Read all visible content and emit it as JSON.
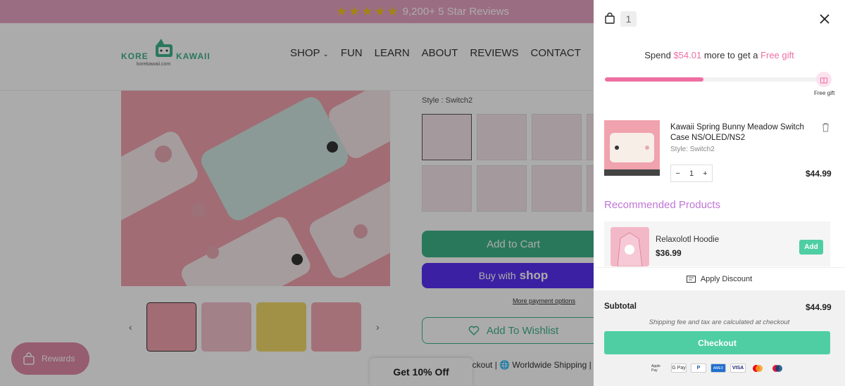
{
  "announcement": {
    "text": "9,200+ 5 Star Reviews",
    "stars": "★★★★★"
  },
  "logo": {
    "left_word": "KORE",
    "right_word": "KAWAII",
    "sub": "korekawaii.com"
  },
  "nav": [
    "SHOP",
    "FUN",
    "LEARN",
    "ABOUT",
    "REVIEWS",
    "CONTACT"
  ],
  "product": {
    "style_label": "Style : Switch2",
    "add_to_cart": "Add to Cart",
    "buy_with": "Buy with",
    "shop_word": "shop",
    "more_payment": "More payment options",
    "wishlist": "Add To Wishlist",
    "shipping_line": "eckout | 🌐 Worldwide Shipping |"
  },
  "popups": {
    "get_off": "Get 10% Off",
    "rewards": "Rewards"
  },
  "cart": {
    "count": "1",
    "spend_prefix": "Spend ",
    "spend_amount": "$54.01",
    "spend_middle": " more to get a ",
    "spend_reward": "Free gift",
    "progress_fraction": 0.45,
    "gift_label": "Free gift",
    "item": {
      "title": "Kawaii Spring Bunny Meadow Switch Case NS/OLED/NS2",
      "style": "Style:  Switch2",
      "qty": "1",
      "price": "$44.99"
    },
    "recommended_title": "Recommended Products",
    "recommended": {
      "name": "Relaxolotl Hoodie",
      "price": "$36.99",
      "add_label": "Add"
    },
    "apply_discount": "Apply Discount",
    "subtotal_label": "Subtotal",
    "subtotal_value": "$44.99",
    "shipping_note": "Shipping fee and tax are calculated at checkout",
    "checkout_label": "Checkout",
    "payment_methods": [
      "Apple Pay",
      "G Pay",
      "PayPal",
      "AMEX",
      "VISA",
      "Mastercard",
      "UnionPay"
    ]
  },
  "colors": {
    "accent_pink": "#ef6ea2",
    "green": "#3fb38a",
    "checkout_green": "#4fcea4",
    "purple": "#c076d6",
    "shop_purple": "#5a31f4"
  }
}
